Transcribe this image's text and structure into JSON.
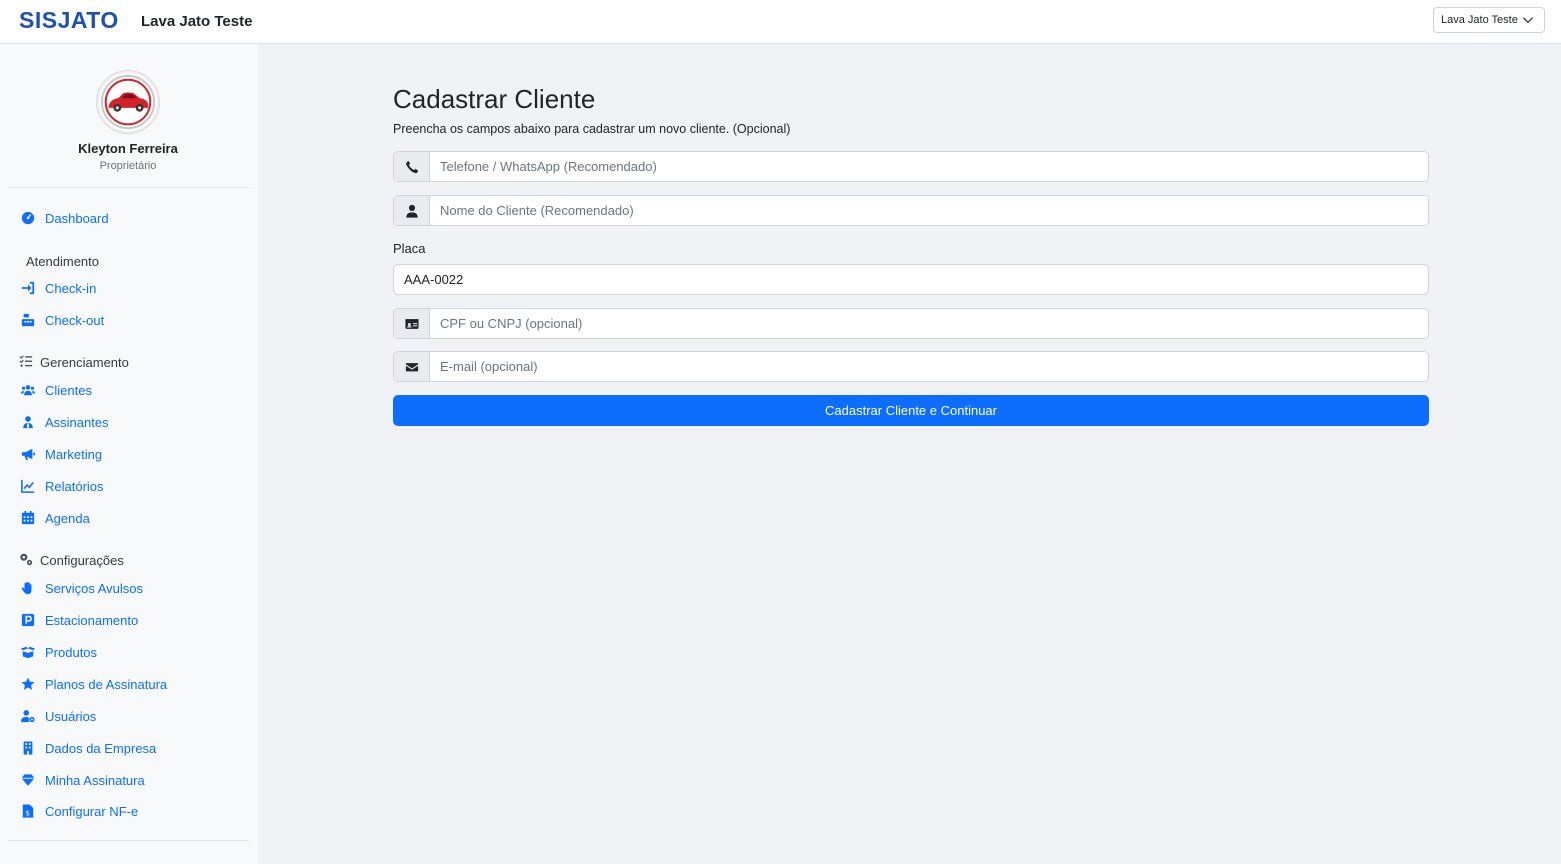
{
  "header": {
    "brand": "SISJATO",
    "company_name": "Lava Jato Teste",
    "company_selector": "Lava Jato Teste"
  },
  "profile": {
    "name": "Kleyton Ferreira",
    "role": "Proprietário"
  },
  "sidebar": {
    "dashboard": "Dashboard",
    "atendimento": {
      "title": "Atendimento",
      "items": [
        "Check-in",
        "Check-out"
      ]
    },
    "gerenciamento": {
      "title": "Gerenciamento",
      "items": [
        "Clientes",
        "Assinantes",
        "Marketing",
        "Relatórios",
        "Agenda"
      ]
    },
    "configuracoes": {
      "title": "Configurações",
      "items": [
        "Serviços Avulsos",
        "Estacionamento",
        "Produtos",
        "Planos de Assinatura",
        "Usuários",
        "Dados da Empresa",
        "Minha Assinatura",
        "Configurar NF-e"
      ]
    }
  },
  "form": {
    "title": "Cadastrar Cliente",
    "subtitle": "Preencha os campos abaixo para cadastrar um novo cliente. (Opcional)",
    "phone_placeholder": "Telefone / WhatsApp (Recomendado)",
    "name_placeholder": "Nome do Cliente (Recomendado)",
    "plate_label": "Placa",
    "plate_value": "AAA-0022",
    "doc_placeholder": "CPF ou CNPJ (opcional)",
    "email_placeholder": "E-mail (opcional)",
    "submit_label": "Cadastrar Cliente e Continuar"
  },
  "colors": {
    "accent": "#0d6efd",
    "brand": "#1e50b4"
  }
}
